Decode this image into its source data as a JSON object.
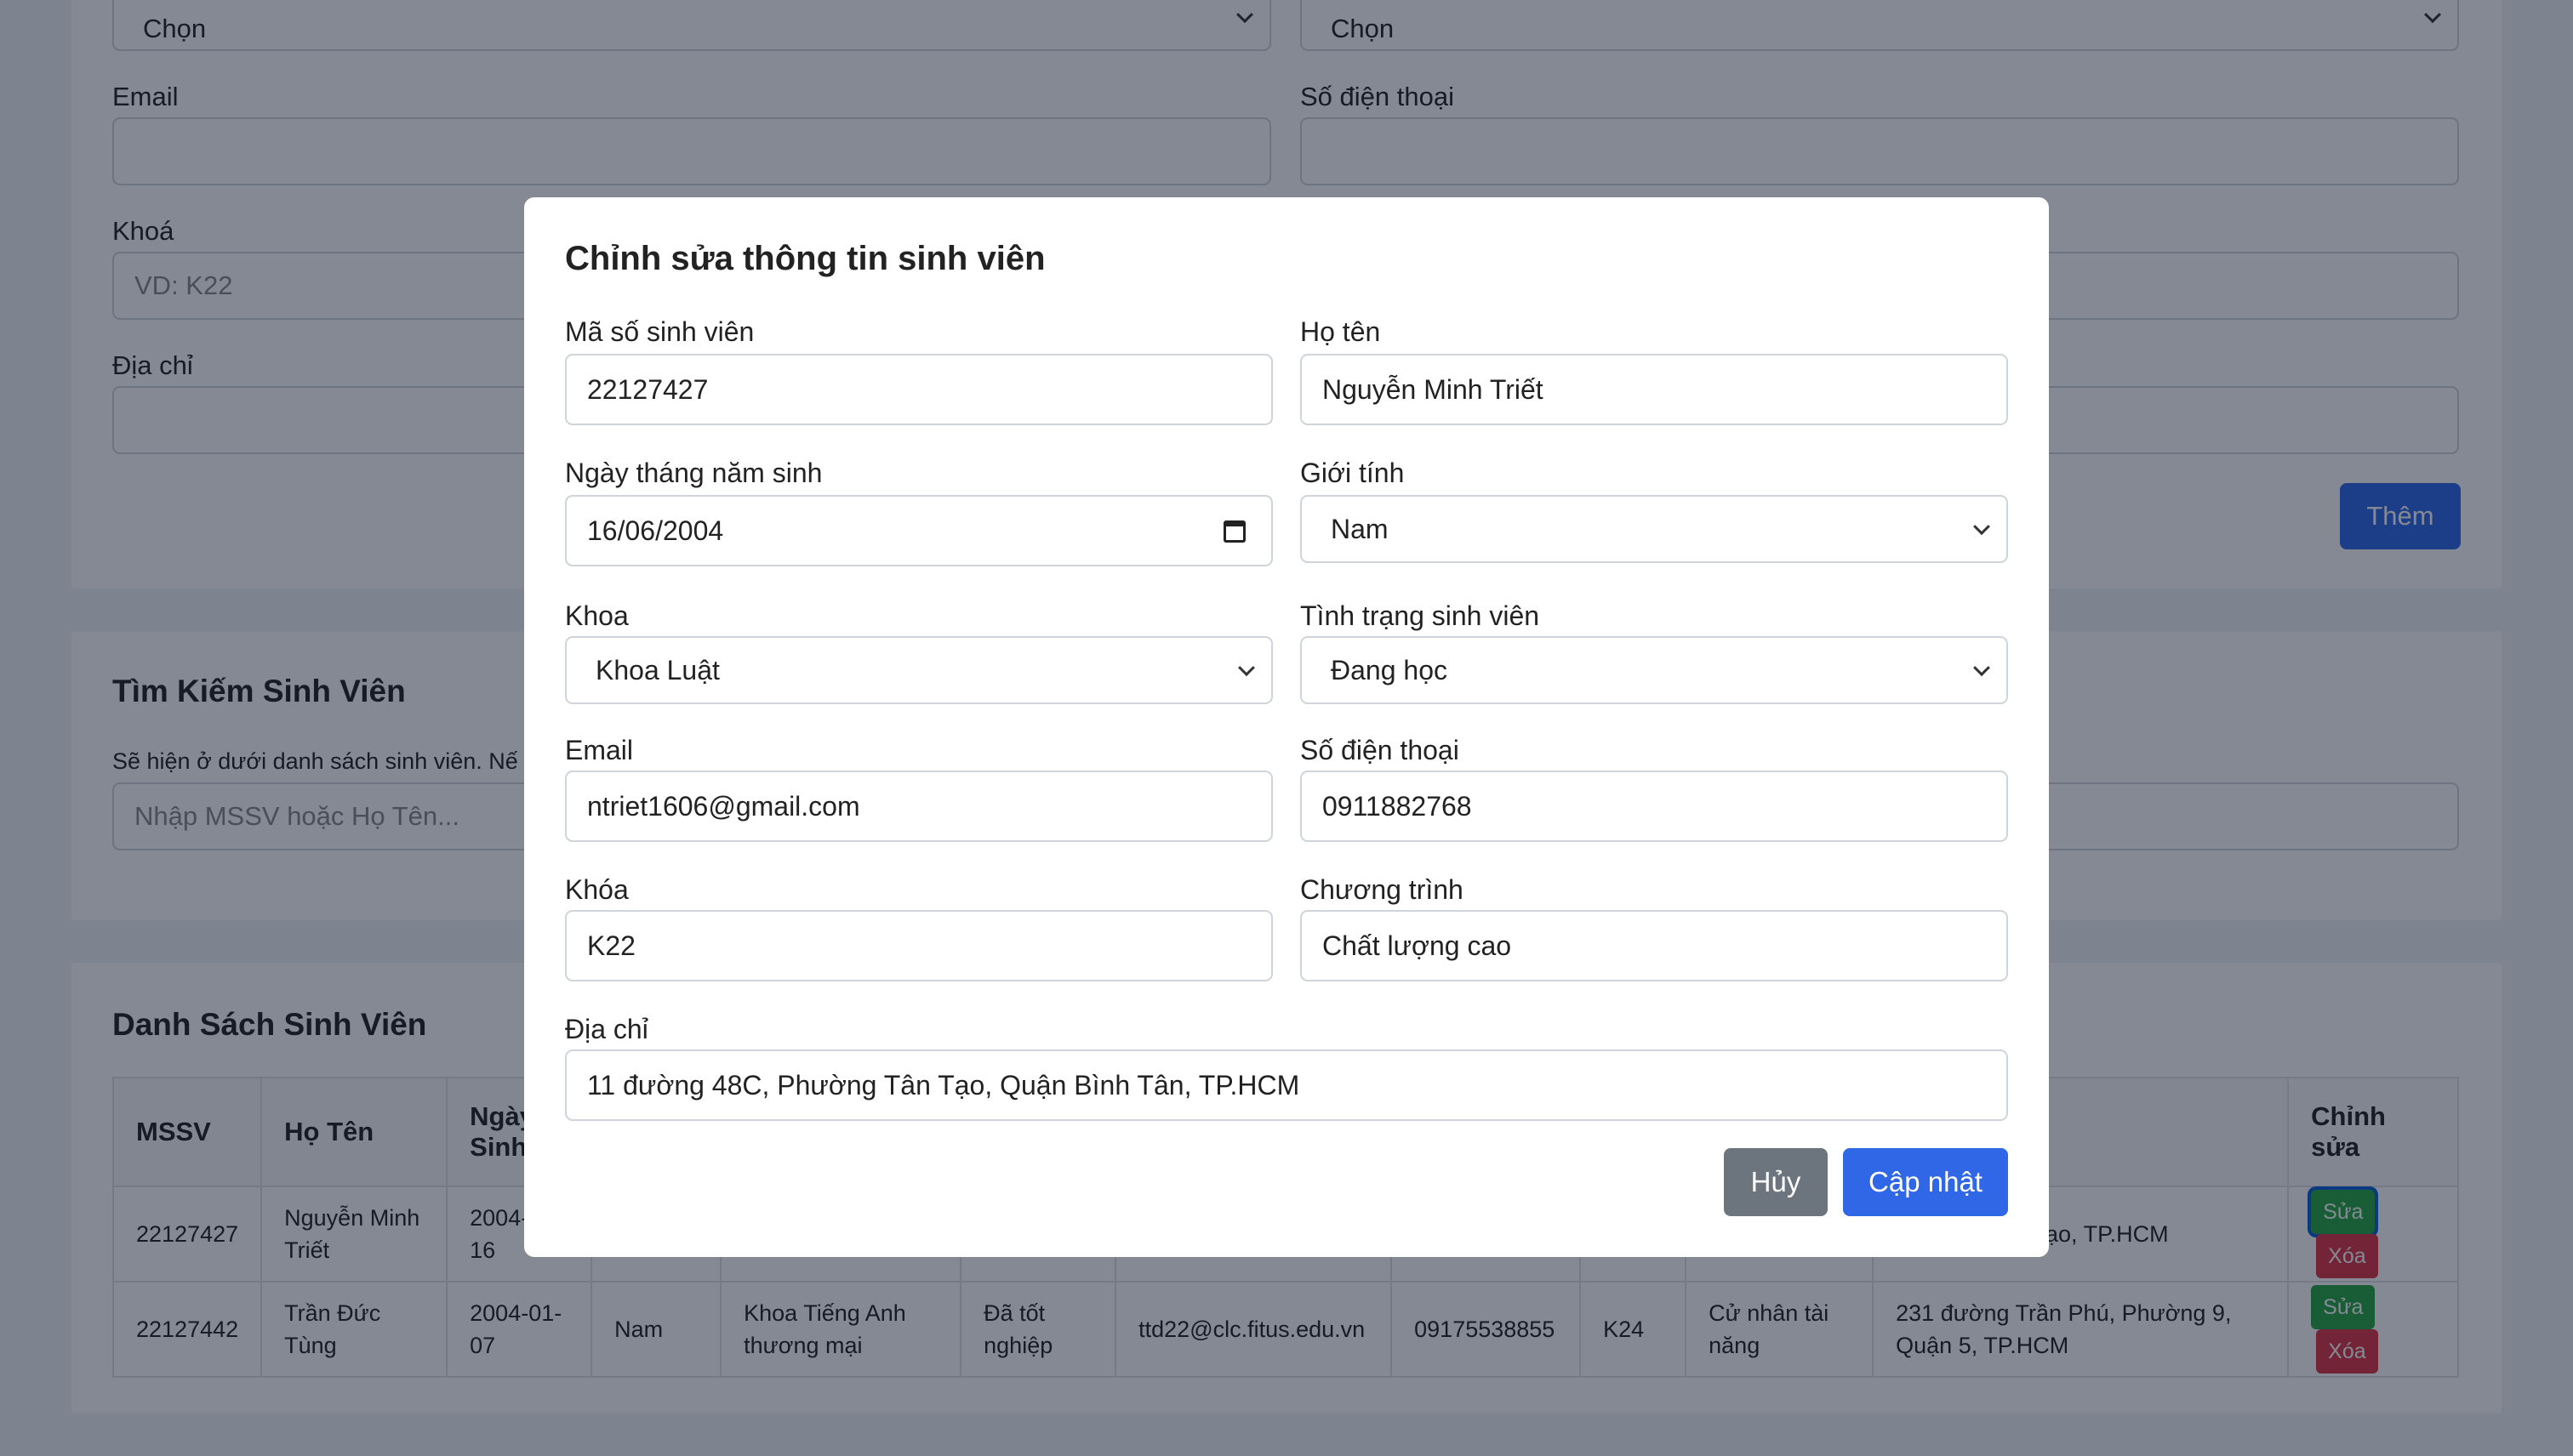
{
  "add_form": {
    "faculty_select_value": "Chọn",
    "status_select_value": "Chọn",
    "email_label": "Email",
    "phone_label": "Số điện thoại",
    "course_label": "Khoá",
    "course_placeholder": "VD: K22",
    "address_label": "Địa chỉ",
    "add_button": "Thêm"
  },
  "search": {
    "title": "Tìm Kiếm Sinh Viên",
    "hint": "Sẽ hiện ở dưới danh sách sinh viên. Nế",
    "placeholder": "Nhập MSSV hoặc Họ Tên..."
  },
  "list": {
    "title": "Danh Sách Sinh Viên",
    "headers": [
      "MSSV",
      "Họ Tên",
      "Ngày Sinh",
      "Chỉnh sửa"
    ],
    "rows": [
      {
        "mssv": "22127427",
        "name": "Nguyễn Minh Triết",
        "dob": "2004-06-16",
        "address": "Phường Tân Tạo, TP.HCM",
        "edit": "Sửa",
        "delete": "Xóa"
      },
      {
        "mssv": "22127442",
        "name": "Trần Đức Tùng",
        "dob": "2004-01-07",
        "gender": "Nam",
        "faculty": "Khoa Tiếng Anh thương mại",
        "status": "Đã tốt nghiệp",
        "email": "ttd22@clc.fitus.edu.vn",
        "phone": "09175538855",
        "course": "K24",
        "program": "Cử nhân tài năng",
        "address": "231 đường Trần Phú, Phường 9, Quận 5, TP.HCM",
        "edit": "Sửa",
        "delete": "Xóa"
      }
    ]
  },
  "modal": {
    "title": "Chỉnh sửa thông tin sinh viên",
    "fields": {
      "mssv_label": "Mã số sinh viên",
      "mssv_value": "22127427",
      "name_label": "Họ tên",
      "name_value": "Nguyễn Minh Triết",
      "dob_label": "Ngày tháng năm sinh",
      "dob_value": "16/06/2004",
      "gender_label": "Giới tính",
      "gender_value": "Nam",
      "faculty_label": "Khoa",
      "faculty_value": "Khoa Luật",
      "status_label": "Tình trạng sinh viên",
      "status_value": "Đang học",
      "email_label": "Email",
      "email_value": "ntriet1606@gmail.com",
      "phone_label": "Số điện thoại",
      "phone_value": "0911882768",
      "course_label": "Khóa",
      "course_value": "K22",
      "program_label": "Chương trình",
      "program_value": "Chất lượng cao",
      "address_label": "Địa chỉ",
      "address_value": "11 đường 48C, Phường Tân Tạo, Quận Bình Tân, TP.HCM"
    },
    "cancel_button": "Hủy",
    "update_button": "Cập nhật"
  },
  "colors": {
    "primary": "#2f67e6",
    "secondary": "#6c757d",
    "success": "#28a745",
    "danger": "#dc3545"
  }
}
